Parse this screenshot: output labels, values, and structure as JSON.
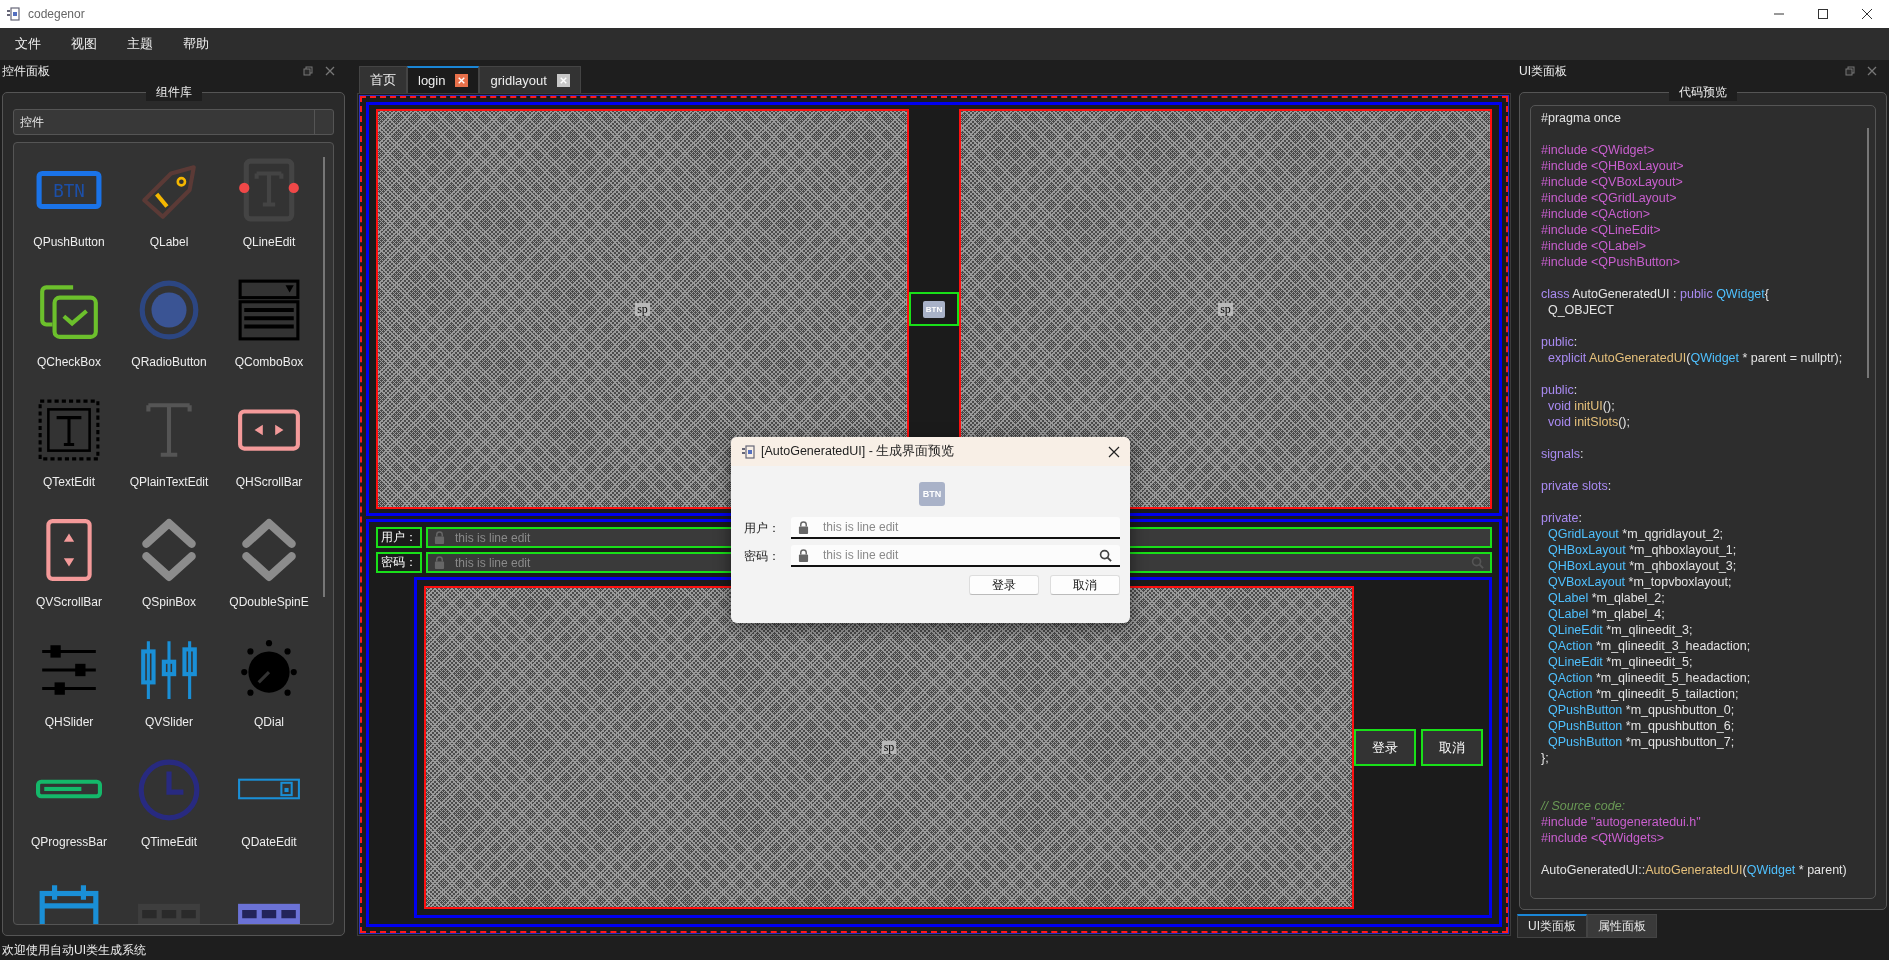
{
  "window": {
    "title": "codegenor"
  },
  "menu": [
    "文件",
    "视图",
    "主题",
    "帮助"
  ],
  "left_panel": {
    "title": "控件面板",
    "group_title": "组件库",
    "combo": {
      "value": "控件"
    },
    "widgets": [
      {
        "kind": "labeled",
        "label": "QPushButton",
        "icon_text": "BTN"
      },
      {
        "kind": "labeled",
        "label": "QLabel"
      },
      {
        "kind": "labeled",
        "label": "QLineEdit"
      },
      {
        "kind": "labeled",
        "label": "QCheckBox"
      },
      {
        "kind": "labeled",
        "label": "QRadioButton"
      },
      {
        "kind": "labeled",
        "label": "QComboBox"
      },
      {
        "kind": "labeled",
        "label": "QTextEdit"
      },
      {
        "kind": "labeled",
        "label": "QPlainTextEdit"
      },
      {
        "kind": "labeled",
        "label": "QHScrollBar"
      },
      {
        "kind": "labeled",
        "label": "QVScrollBar"
      },
      {
        "kind": "labeled",
        "label": "QSpinBox"
      },
      {
        "kind": "labeled",
        "label": "QDoubleSpinE"
      },
      {
        "kind": "labeled",
        "label": "QHSlider"
      },
      {
        "kind": "labeled",
        "label": "QVSlider"
      },
      {
        "kind": "labeled",
        "label": "QDial"
      },
      {
        "kind": "labeled",
        "label": "QProgressBar"
      },
      {
        "kind": "labeled",
        "label": "QTimeEdit"
      },
      {
        "kind": "labeled",
        "label": "QDateEdit"
      },
      {
        "kind": "icon_only"
      },
      {
        "kind": "icon_only"
      },
      {
        "kind": "icon_only"
      }
    ]
  },
  "editor_tabs": [
    {
      "label": "首页",
      "selected": false,
      "closable": false
    },
    {
      "label": "login",
      "selected": true,
      "closable": true
    },
    {
      "label": "gridlayout",
      "selected": false,
      "closable": true
    }
  ],
  "canvas": {
    "top_left_spacer": "sp",
    "button_text": "BTN",
    "top_right_spacer": "sp",
    "rows": [
      {
        "label": "用户：",
        "placeholder": "this is line edit",
        "search": false
      },
      {
        "label": "密码：",
        "placeholder": "this is line edit",
        "search": true
      }
    ],
    "bottom_spacer": "sp",
    "buttons": [
      "登录",
      "取消"
    ]
  },
  "dialog": {
    "title": "[AutoGeneratedUI] - 生成界面预览",
    "button_text": "BTN",
    "rows": [
      {
        "label": "用户：",
        "placeholder": "this is line edit",
        "search": false
      },
      {
        "label": "密码：",
        "placeholder": "this is line edit",
        "search": true
      }
    ],
    "buttons": [
      "登录",
      "取消"
    ]
  },
  "right_panel": {
    "title": "UI类面板",
    "group_title": "代码预览",
    "code": [
      {
        "kind": "code",
        "segments": [
          {
            "kind": "plain",
            "t": "#pragma once"
          }
        ]
      },
      {
        "kind": "blank"
      },
      {
        "kind": "code",
        "segments": [
          {
            "kind": "preproc",
            "t": "#include <QWidget>"
          }
        ]
      },
      {
        "kind": "code",
        "segments": [
          {
            "kind": "preproc",
            "t": "#include <QHBoxLayout>"
          }
        ]
      },
      {
        "kind": "code",
        "segments": [
          {
            "kind": "preproc",
            "t": "#include <QVBoxLayout>"
          }
        ]
      },
      {
        "kind": "code",
        "segments": [
          {
            "kind": "preproc",
            "t": "#include <QGridLayout>"
          }
        ]
      },
      {
        "kind": "code",
        "segments": [
          {
            "kind": "preproc",
            "t": "#include <QAction>"
          }
        ]
      },
      {
        "kind": "code",
        "segments": [
          {
            "kind": "preproc",
            "t": "#include <QLineEdit>"
          }
        ]
      },
      {
        "kind": "code",
        "segments": [
          {
            "kind": "preproc",
            "t": "#include <QLabel>"
          }
        ]
      },
      {
        "kind": "code",
        "segments": [
          {
            "kind": "preproc",
            "t": "#include <QPushButton>"
          }
        ]
      },
      {
        "kind": "blank"
      },
      {
        "kind": "code",
        "segments": [
          {
            "kind": "keyword",
            "t": "class"
          },
          {
            "kind": "plain",
            "t": " AutoGeneratedUI : "
          },
          {
            "kind": "keyword",
            "t": "public"
          },
          {
            "kind": "type",
            "t": " QWidget"
          },
          {
            "kind": "plain",
            "t": "{"
          }
        ]
      },
      {
        "kind": "code",
        "segments": [
          {
            "kind": "plain",
            "t": "  Q_OBJECT"
          }
        ]
      },
      {
        "kind": "blank"
      },
      {
        "kind": "code",
        "segments": [
          {
            "kind": "keyword",
            "t": "public"
          },
          {
            "kind": "plain",
            "t": ":"
          }
        ]
      },
      {
        "kind": "code",
        "segments": [
          {
            "kind": "keyword",
            "t": "  explicit"
          },
          {
            "kind": "function",
            "t": " AutoGeneratedUI"
          },
          {
            "kind": "plain",
            "t": "("
          },
          {
            "kind": "type",
            "t": "QWidget"
          },
          {
            "kind": "plain",
            "t": " * parent = nullptr);"
          }
        ]
      },
      {
        "kind": "blank"
      },
      {
        "kind": "code",
        "segments": [
          {
            "kind": "keyword",
            "t": "public"
          },
          {
            "kind": "plain",
            "t": ":"
          }
        ]
      },
      {
        "kind": "code",
        "segments": [
          {
            "kind": "keyword",
            "t": "  void"
          },
          {
            "kind": "function",
            "t": " initUI"
          },
          {
            "kind": "plain",
            "t": "();"
          }
        ]
      },
      {
        "kind": "code",
        "segments": [
          {
            "kind": "keyword",
            "t": "  void"
          },
          {
            "kind": "function",
            "t": " initSlots"
          },
          {
            "kind": "plain",
            "t": "();"
          }
        ]
      },
      {
        "kind": "blank"
      },
      {
        "kind": "code",
        "segments": [
          {
            "kind": "keyword",
            "t": "signals"
          },
          {
            "kind": "plain",
            "t": ":"
          }
        ]
      },
      {
        "kind": "blank"
      },
      {
        "kind": "code",
        "segments": [
          {
            "kind": "keyword",
            "t": "private slots"
          },
          {
            "kind": "plain",
            "t": ":"
          }
        ]
      },
      {
        "kind": "blank"
      },
      {
        "kind": "code",
        "segments": [
          {
            "kind": "keyword",
            "t": "private"
          },
          {
            "kind": "plain",
            "t": ":"
          }
        ]
      },
      {
        "kind": "code",
        "segments": [
          {
            "kind": "type",
            "t": "  QGridLayout"
          },
          {
            "kind": "plain",
            "t": " *m_qgridlayout_2;"
          }
        ]
      },
      {
        "kind": "code",
        "segments": [
          {
            "kind": "type",
            "t": "  QHBoxLayout"
          },
          {
            "kind": "plain",
            "t": " *m_qhboxlayout_1;"
          }
        ]
      },
      {
        "kind": "code",
        "segments": [
          {
            "kind": "type",
            "t": "  QHBoxLayout"
          },
          {
            "kind": "plain",
            "t": " *m_qhboxlayout_3;"
          }
        ]
      },
      {
        "kind": "code",
        "segments": [
          {
            "kind": "type",
            "t": "  QVBoxLayout"
          },
          {
            "kind": "plain",
            "t": " *m_topvboxlayout;"
          }
        ]
      },
      {
        "kind": "code",
        "segments": [
          {
            "kind": "type",
            "t": "  QLabel"
          },
          {
            "kind": "plain",
            "t": " *m_qlabel_2;"
          }
        ]
      },
      {
        "kind": "code",
        "segments": [
          {
            "kind": "type",
            "t": "  QLabel"
          },
          {
            "kind": "plain",
            "t": " *m_qlabel_4;"
          }
        ]
      },
      {
        "kind": "code",
        "segments": [
          {
            "kind": "type",
            "t": "  QLineEdit"
          },
          {
            "kind": "plain",
            "t": " *m_qlineedit_3;"
          }
        ]
      },
      {
        "kind": "code",
        "segments": [
          {
            "kind": "type",
            "t": "  QAction"
          },
          {
            "kind": "plain",
            "t": " *m_qlineedit_3_headaction;"
          }
        ]
      },
      {
        "kind": "code",
        "segments": [
          {
            "kind": "type",
            "t": "  QLineEdit"
          },
          {
            "kind": "plain",
            "t": " *m_qlineedit_5;"
          }
        ]
      },
      {
        "kind": "code",
        "segments": [
          {
            "kind": "type",
            "t": "  QAction"
          },
          {
            "kind": "plain",
            "t": " *m_qlineedit_5_headaction;"
          }
        ]
      },
      {
        "kind": "code",
        "segments": [
          {
            "kind": "type",
            "t": "  QAction"
          },
          {
            "kind": "plain",
            "t": " *m_qlineedit_5_tailaction;"
          }
        ]
      },
      {
        "kind": "code",
        "segments": [
          {
            "kind": "type",
            "t": "  QPushButton"
          },
          {
            "kind": "plain",
            "t": " *m_qpushbutton_0;"
          }
        ]
      },
      {
        "kind": "code",
        "segments": [
          {
            "kind": "type",
            "t": "  QPushButton"
          },
          {
            "kind": "plain",
            "t": " *m_qpushbutton_6;"
          }
        ]
      },
      {
        "kind": "code",
        "segments": [
          {
            "kind": "type",
            "t": "  QPushButton"
          },
          {
            "kind": "plain",
            "t": " *m_qpushbutton_7;"
          }
        ]
      },
      {
        "kind": "code",
        "segments": [
          {
            "kind": "plain",
            "t": "};"
          }
        ]
      },
      {
        "kind": "blank"
      },
      {
        "kind": "blank"
      },
      {
        "kind": "code",
        "segments": [
          {
            "kind": "comment",
            "t": "// Source code:"
          }
        ]
      },
      {
        "kind": "code",
        "segments": [
          {
            "kind": "preproc",
            "t": "#include \"autogeneratedui.h\""
          }
        ]
      },
      {
        "kind": "code",
        "segments": [
          {
            "kind": "preproc",
            "t": "#include <QtWidgets>"
          }
        ]
      },
      {
        "kind": "blank"
      },
      {
        "kind": "code",
        "segments": [
          {
            "kind": "plain",
            "t": "AutoGeneratedUI::"
          },
          {
            "kind": "function",
            "t": "AutoGeneratedUI"
          },
          {
            "kind": "plain",
            "t": "("
          },
          {
            "kind": "type",
            "t": "QWidget"
          },
          {
            "kind": "plain",
            "t": " * parent)"
          }
        ]
      }
    ],
    "tabs": [
      {
        "label": "UI类面板",
        "selected": true
      },
      {
        "label": "属性面板",
        "selected": false
      }
    ]
  },
  "status_bar": "欢迎使用自动UI类生成系统"
}
